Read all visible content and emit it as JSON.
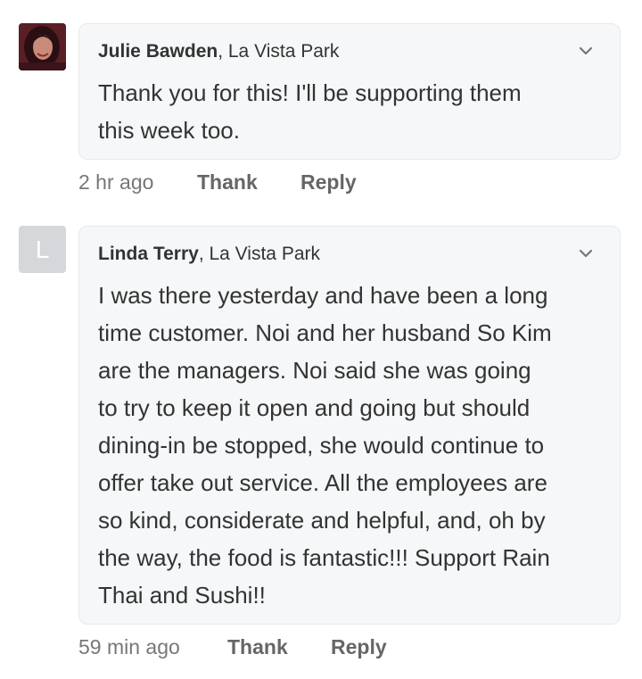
{
  "comments": [
    {
      "avatar": {
        "type": "photo",
        "icon": "user-photo-avatar",
        "color": "#6b2a30"
      },
      "author": "Julie Bawden",
      "location": ", La Vista Park",
      "text": "Thank you for this! I'll be supporting them\nthis week too.",
      "time": "2 hr ago",
      "thank_label": "Thank",
      "reply_label": "Reply"
    },
    {
      "avatar": {
        "type": "initial",
        "letter": "L",
        "color": "#d5d7da"
      },
      "author": "Linda Terry",
      "location": ", La Vista Park",
      "text": "I was there yesterday and have been a long\ntime customer.  Noi and her husband So Kim\nare the managers.  Noi said she was going\nto try to keep it open and going but should\ndining-in be stopped, she would continue to\noffer take out service.  All the employees are\nso kind, considerate and helpful, and, oh by\nthe way, the food is fantastic!!!  Support Rain\nThai and Sushi!!",
      "time": "59 min ago",
      "thank_label": "Thank",
      "reply_label": "Reply"
    }
  ],
  "icons": {
    "menu": "chevron-down-icon"
  },
  "colors": {
    "bubble_bg": "#f6f7f8",
    "bubble_border": "#e6e8ea",
    "text": "#333333",
    "meta": "#777777"
  }
}
